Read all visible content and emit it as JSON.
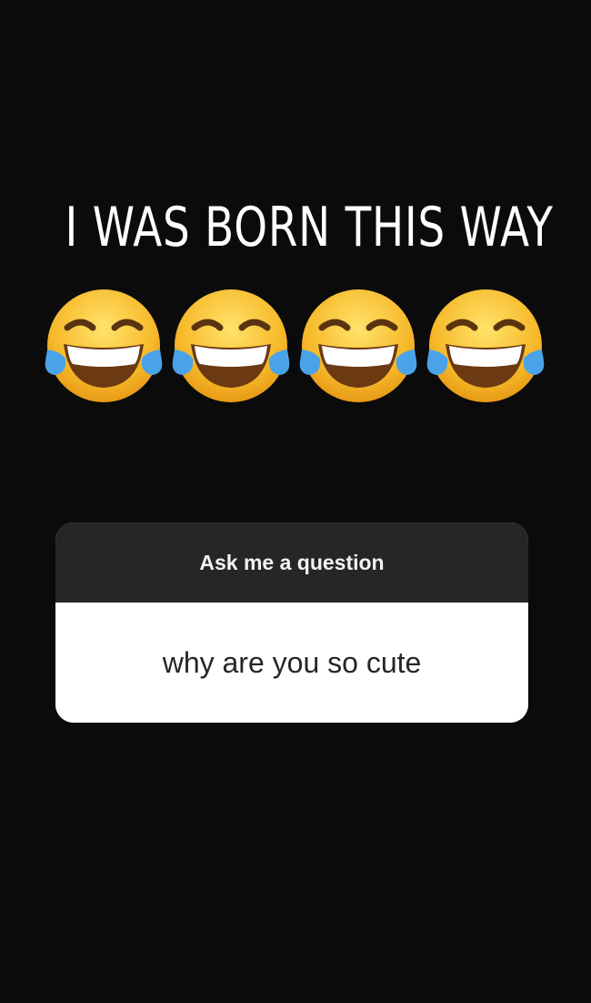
{
  "story": {
    "headline": "I WAS BORN THIS WAY",
    "background_color": "#0b0b0b",
    "emojis": [
      {
        "icon": "face-with-tears-of-joy-icon"
      },
      {
        "icon": "face-with-tears-of-joy-icon"
      },
      {
        "icon": "face-with-tears-of-joy-icon"
      },
      {
        "icon": "face-with-tears-of-joy-icon"
      }
    ],
    "question_sticker": {
      "prompt": "Ask me a question",
      "answer": "why are you so cute",
      "header_color": "#262626",
      "body_color": "#ffffff"
    }
  }
}
